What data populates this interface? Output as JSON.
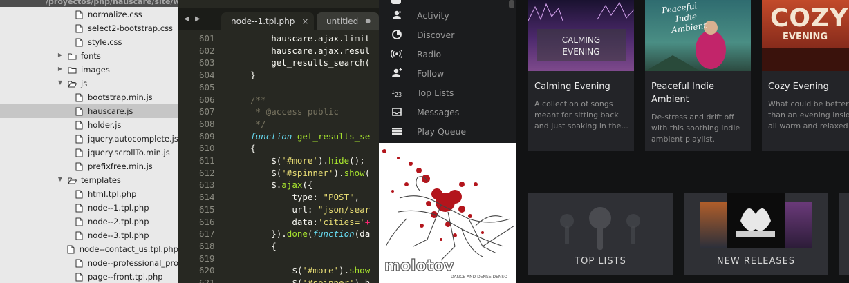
{
  "file_tree": {
    "path": "/proyectos/php/hauscare/site/wp-content/themes/hauscare/js/hauscare.js",
    "items": [
      {
        "label": "normalize.css",
        "kind": "file",
        "indent": 2
      },
      {
        "label": "select2-bootstrap.css",
        "kind": "file",
        "indent": 2
      },
      {
        "label": "style.css",
        "kind": "file",
        "indent": 2
      },
      {
        "label": "fonts",
        "kind": "folder-closed",
        "indent": 1
      },
      {
        "label": "images",
        "kind": "folder-closed",
        "indent": 1
      },
      {
        "label": "js",
        "kind": "folder-open",
        "indent": 1
      },
      {
        "label": "bootstrap.min.js",
        "kind": "file",
        "indent": 2
      },
      {
        "label": "hauscare.js",
        "kind": "file",
        "indent": 2,
        "selected": true
      },
      {
        "label": "holder.js",
        "kind": "file",
        "indent": 2
      },
      {
        "label": "jquery.autocomplete.js",
        "kind": "file",
        "indent": 2
      },
      {
        "label": "jquery.scrollTo.min.js",
        "kind": "file",
        "indent": 2
      },
      {
        "label": "prefixfree.min.js",
        "kind": "file",
        "indent": 2
      },
      {
        "label": "templates",
        "kind": "folder-open",
        "indent": 1
      },
      {
        "label": "html.tpl.php",
        "kind": "file",
        "indent": 2
      },
      {
        "label": "node--1.tpl.php",
        "kind": "file",
        "indent": 2
      },
      {
        "label": "node--2.tpl.php",
        "kind": "file",
        "indent": 2
      },
      {
        "label": "node--3.tpl.php",
        "kind": "file",
        "indent": 2
      },
      {
        "label": "node--contact_us.tpl.php",
        "kind": "file",
        "indent": 2
      },
      {
        "label": "node--professional_pro",
        "kind": "file",
        "indent": 2
      },
      {
        "label": "page--front.tpl.php",
        "kind": "file",
        "indent": 2
      }
    ]
  },
  "editor": {
    "tabs": [
      {
        "label": "node--1.tpl.php",
        "active": true,
        "close": "×"
      },
      {
        "label": "untitled",
        "active": false,
        "close": "●"
      }
    ],
    "nav_prev": "◀",
    "nav_next": "▶",
    "lines": [
      {
        "n": "601",
        "indent": "        ",
        "tokens": [
          [
            "v",
            "hauscare.ajax.limit"
          ]
        ]
      },
      {
        "n": "602",
        "indent": "        ",
        "tokens": [
          [
            "v",
            "hauscare.ajax.resul"
          ]
        ]
      },
      {
        "n": "603",
        "indent": "        ",
        "tokens": [
          [
            "v",
            "get_results_search("
          ]
        ]
      },
      {
        "n": "604",
        "indent": "    ",
        "tokens": [
          [
            "v",
            "}"
          ]
        ]
      },
      {
        "n": "605",
        "indent": "",
        "tokens": []
      },
      {
        "n": "606",
        "indent": "    ",
        "tokens": [
          [
            "c",
            "/**"
          ]
        ]
      },
      {
        "n": "607",
        "indent": "     ",
        "tokens": [
          [
            "c",
            "* @access public"
          ]
        ]
      },
      {
        "n": "608",
        "indent": "     ",
        "tokens": [
          [
            "c",
            "*/"
          ]
        ]
      },
      {
        "n": "609",
        "indent": "    ",
        "tokens": [
          [
            "k",
            "function"
          ],
          [
            "v",
            " "
          ],
          [
            "f",
            "get_results_se"
          ]
        ]
      },
      {
        "n": "610",
        "indent": "    ",
        "tokens": [
          [
            "v",
            "{"
          ]
        ]
      },
      {
        "n": "611",
        "indent": "        ",
        "tokens": [
          [
            "v",
            "$("
          ],
          [
            "s",
            "'#more'"
          ],
          [
            "v",
            ")."
          ],
          [
            "f",
            "hide"
          ],
          [
            "v",
            "();"
          ]
        ]
      },
      {
        "n": "612",
        "indent": "        ",
        "tokens": [
          [
            "v",
            "$("
          ],
          [
            "s",
            "'#spinner'"
          ],
          [
            "v",
            ")."
          ],
          [
            "f",
            "show"
          ],
          [
            "v",
            "("
          ]
        ]
      },
      {
        "n": "613",
        "indent": "        ",
        "tokens": [
          [
            "v",
            "$."
          ],
          [
            "f",
            "ajax"
          ],
          [
            "v",
            "({"
          ]
        ]
      },
      {
        "n": "614",
        "indent": "            ",
        "tokens": [
          [
            "v",
            "type: "
          ],
          [
            "s",
            "\"POST\""
          ],
          [
            "v",
            ","
          ]
        ]
      },
      {
        "n": "615",
        "indent": "            ",
        "tokens": [
          [
            "v",
            "url: "
          ],
          [
            "s",
            "\"json/sear"
          ]
        ]
      },
      {
        "n": "616",
        "indent": "            ",
        "tokens": [
          [
            "v",
            "data:"
          ],
          [
            "s",
            "'cities='"
          ],
          [
            "r",
            "+"
          ]
        ]
      },
      {
        "n": "617",
        "indent": "        ",
        "tokens": [
          [
            "v",
            "})."
          ],
          [
            "f",
            "done"
          ],
          [
            "v",
            "("
          ],
          [
            "k",
            "function"
          ],
          [
            "v",
            "(da"
          ]
        ]
      },
      {
        "n": "618",
        "indent": "        ",
        "tokens": [
          [
            "v",
            "{"
          ]
        ]
      },
      {
        "n": "619",
        "indent": "",
        "tokens": []
      },
      {
        "n": "620",
        "indent": "            ",
        "tokens": [
          [
            "v",
            "$("
          ],
          [
            "s",
            "'#more'"
          ],
          [
            "v",
            ")."
          ],
          [
            "f",
            "show"
          ]
        ]
      },
      {
        "n": "621",
        "indent": "            ",
        "tokens": [
          [
            "v",
            "$("
          ],
          [
            "s",
            "'#spinner'"
          ],
          [
            "v",
            ").h"
          ]
        ]
      }
    ]
  },
  "spotify_menu": {
    "items": [
      {
        "label": "Activity",
        "icon": "activity-icon"
      },
      {
        "label": "Discover",
        "icon": "discover-icon"
      },
      {
        "label": "Radio",
        "icon": "radio-icon"
      },
      {
        "label": "Follow",
        "icon": "follow-icon"
      },
      {
        "label": "Top Lists",
        "icon": "top-lists-icon"
      },
      {
        "label": "Messages",
        "icon": "messages-icon"
      },
      {
        "label": "Play Queue",
        "icon": "play-queue-icon"
      }
    ]
  },
  "album_art": {
    "band": "molotov",
    "subtitle": "DANCE AND DENSE DENSO"
  },
  "playlists": [
    {
      "title": "Calming Evening",
      "description": "A collection of songs meant for sitting back and just soaking in the...",
      "cover_text": [
        "CALMING",
        "EVENING"
      ]
    },
    {
      "title": "Peaceful Indie Ambient",
      "description": "De-stress and drift off with this soothing indie ambient playlist.",
      "cover_text": [
        "Peaceful",
        "Indie",
        "Ambient"
      ]
    },
    {
      "title": "Cozy Evening",
      "description": "What could be better than an evening inside, all warm and relaxed or...",
      "cover_text": [
        "COZY",
        "EVENING"
      ]
    }
  ],
  "tiles": [
    {
      "label": "TOP LISTS"
    },
    {
      "label": "NEW RELEASES"
    }
  ],
  "colors": {
    "editor_bg": "#272822",
    "sidebar_bg": "#1b1c1e",
    "content_bg": "#121314",
    "card_bg": "#232428",
    "tree_bg": "#e9e9e9",
    "tree_selected": "#c6c6c6"
  }
}
